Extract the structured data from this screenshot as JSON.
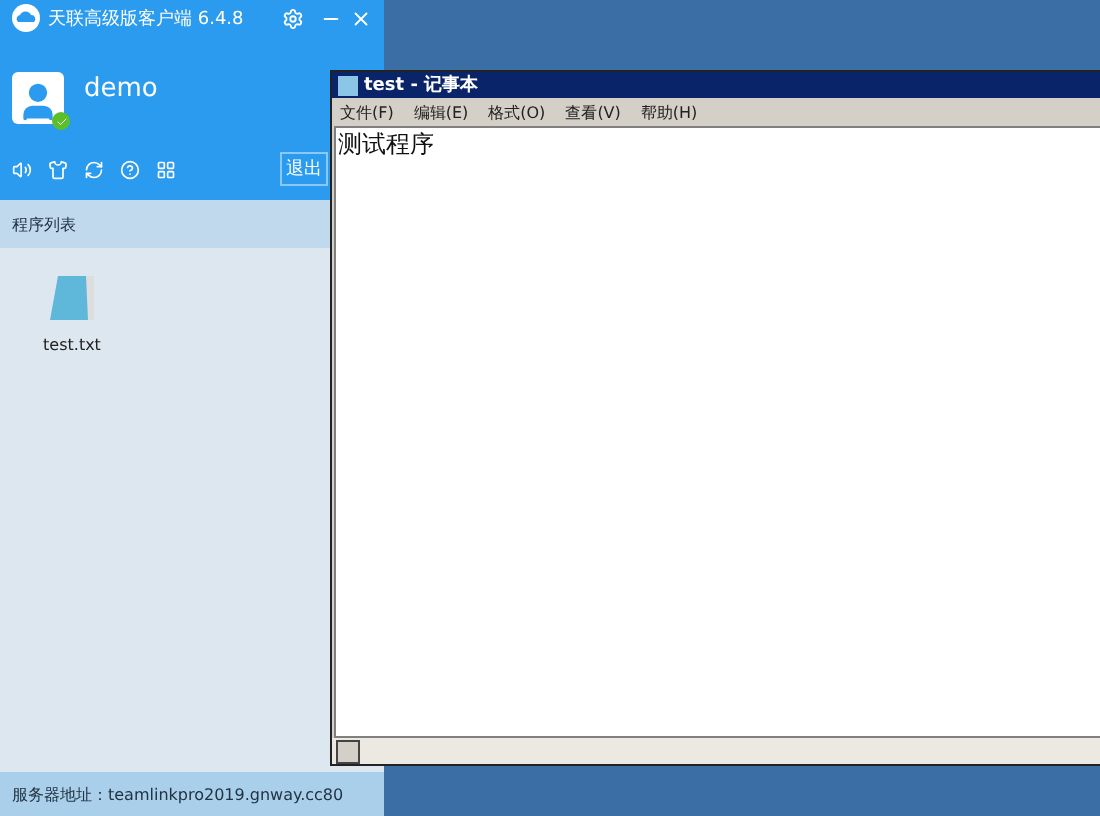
{
  "client": {
    "title": "天联高级版客户端 6.4.8",
    "user": {
      "name": "demo",
      "online": true
    },
    "logout_button": "退出",
    "section": "程序列表",
    "programs": [
      {
        "name": "test.txt"
      }
    ],
    "status_bar": "服务器地址：teamlinkpro2019.gnway.cc80"
  },
  "notepad": {
    "title": "test - 记事本",
    "menu": [
      "文件(F)",
      "编辑(E)",
      "格式(O)",
      "查看(V)",
      "帮助(H)"
    ],
    "content": "测试程序"
  }
}
